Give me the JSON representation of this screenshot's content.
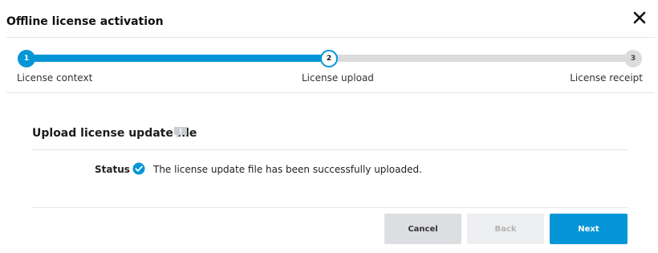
{
  "dialog": {
    "title": "Offline license activation",
    "close_icon": "close-icon"
  },
  "stepper": {
    "progress_fraction": 0.5,
    "active_color": "#0696d7",
    "steps": [
      {
        "number": "1",
        "label": "License context",
        "state": "done"
      },
      {
        "number": "2",
        "label": "License upload",
        "state": "current"
      },
      {
        "number": "3",
        "label": "License receipt",
        "state": "future"
      }
    ]
  },
  "section": {
    "title": "Upload license update file",
    "feedback_icon": "feedback-icon",
    "status_label": "Status",
    "status_icon": "check-circle-icon",
    "status_text": "The license update file has been successfully uploaded."
  },
  "buttons": {
    "cancel": "Cancel",
    "back": "Back",
    "next": "Next"
  }
}
